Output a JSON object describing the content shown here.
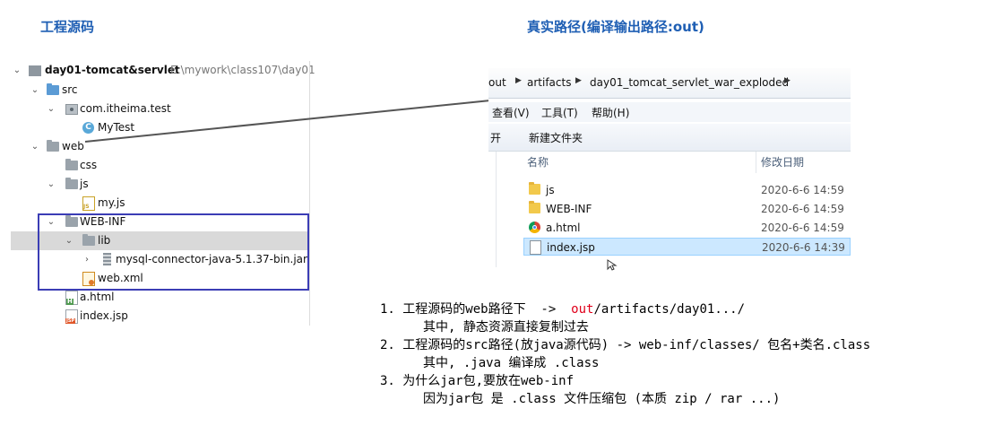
{
  "headings": {
    "source": "工程源码",
    "real_path": "真实路径(编译输出路径:out)"
  },
  "tree": {
    "project_name": "day01-tomcat&servlet",
    "project_path": "E:\\mywork\\class107\\day01",
    "items": [
      {
        "label": "src"
      },
      {
        "label": "com.itheima.test"
      },
      {
        "label": "MyTest"
      },
      {
        "label": "web"
      },
      {
        "label": "css"
      },
      {
        "label": "js"
      },
      {
        "label": "my.js"
      },
      {
        "label": "WEB-INF"
      },
      {
        "label": "lib"
      },
      {
        "label": "mysql-connector-java-5.1.37-bin.jar"
      },
      {
        "label": "web.xml"
      },
      {
        "label": "a.html"
      },
      {
        "label": "index.jsp"
      }
    ],
    "highlight_color": "#3b3db5"
  },
  "explorer": {
    "breadcrumbs": [
      "out",
      "artifacts",
      "day01_tomcat_servlet_war_exploded"
    ],
    "menu": [
      "查看(V)",
      "工具(T)",
      "帮助(H)"
    ],
    "toolbar": [
      "开",
      "新建文件夹"
    ],
    "columns": {
      "name": "名称",
      "date": "修改日期"
    },
    "files": [
      {
        "name": "js",
        "date": "2020-6-6 14:59",
        "icon": "folder-icon"
      },
      {
        "name": "WEB-INF",
        "date": "2020-6-6 14:59",
        "icon": "folder-icon"
      },
      {
        "name": "a.html",
        "date": "2020-6-6 14:59",
        "icon": "chrome-icon"
      },
      {
        "name": "index.jsp",
        "date": "2020-6-6 14:39",
        "icon": "file-icon"
      }
    ]
  },
  "notes": {
    "n1a": "1. 工程源码的web路径下  ->  ",
    "n1_red": "out",
    "n1b": "/artifacts/day01.../",
    "n1_sub": "其中, 静态资源直接复制过去",
    "n2": "2. 工程源码的src路径(放java源代码) -> web-inf/classes/ 包名+类名.class",
    "n2_sub": "其中, .java 编译成 .class",
    "n3": "3. 为什么jar包,要放在web-inf",
    "n3_sub": "因为jar包 是 .class 文件压缩包 (本质 zip / rar ...)"
  }
}
